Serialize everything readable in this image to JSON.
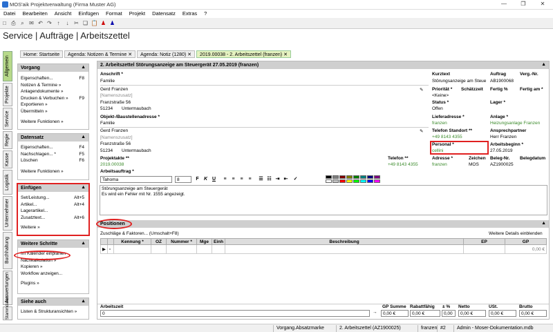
{
  "window": {
    "title": "MOS'aik Projektverwaltung (Firma Muster AG)",
    "min": "—",
    "max": "❐",
    "close": "✕"
  },
  "menu": [
    "Datei",
    "Bearbeiten",
    "Ansicht",
    "Einfügen",
    "Format",
    "Projekt",
    "Datensatz",
    "Extras",
    "?"
  ],
  "app_title": "Service | Aufträge | Arbeitszettel",
  "tabs": [
    {
      "label": "Home: Startseite"
    },
    {
      "label": "Agenda: Notizen & Termine"
    },
    {
      "label": "Agenda: Notiz (1280)"
    },
    {
      "label": "2019.00038 - 2. Arbeitszettel (franzen)"
    }
  ],
  "tab_close": "✕",
  "vtabs": [
    "Allgemein",
    "Projekte",
    "Service",
    "Regie",
    "Kasse",
    "Logistik",
    "Unternehmer",
    "Buchhaltung",
    "Auswertungen",
    "Stammdaten"
  ],
  "left": {
    "vorgang": {
      "title": "Vorgang",
      "items": [
        {
          "label": "Eigenschaften...",
          "key": "F8"
        },
        {
          "label": "Notizen & Termine »",
          "key": ""
        },
        {
          "label": "Anlagendokumente »",
          "key": ""
        },
        {
          "label": "Drucken & Verbuchen »",
          "key": "F9"
        },
        {
          "label": "Exportieren »",
          "key": ""
        },
        {
          "label": "Übermitteln »",
          "key": ""
        }
      ],
      "more": "Weitere Funktionen »"
    },
    "datensatz": {
      "title": "Datensatz",
      "items": [
        {
          "label": "Eigenschaften...",
          "key": "F4"
        },
        {
          "label": "Nachschlagen... *",
          "key": "F5"
        },
        {
          "label": "Löschen",
          "key": "F6"
        }
      ],
      "more": "Weitere Funktionen »"
    },
    "einfuegen": {
      "title": "Einfügen",
      "items": [
        {
          "label": "Set/Leistung...",
          "key": "Alt+5"
        },
        {
          "label": "Artikel...",
          "key": "Alt+4"
        },
        {
          "label": "Lagerartikel...",
          "key": ""
        },
        {
          "label": "Zusatztext...",
          "key": "Alt+6"
        }
      ],
      "more": "Weitere »"
    },
    "schritte": {
      "title": "Weitere Schritte",
      "items": [
        {
          "label": "Im Kalender einplanen",
          "key": ""
        },
        {
          "label": "Nachkalkulation »",
          "key": ""
        },
        {
          "label": "Kopieren »",
          "key": ""
        },
        {
          "label": "Workflow anzeigen...",
          "key": ""
        }
      ],
      "more": "Plugins »"
    },
    "siehe": {
      "title": "Siehe auch",
      "items": [
        {
          "label": "Listen & Strukturansichten »",
          "key": ""
        }
      ]
    }
  },
  "form": {
    "header": "2. Arbeitszettel Störungsanzeige am Steuergerät 27.05.2019 (franzen)",
    "anschrift_lbl": "Anschrift *",
    "anschrift_art": "Familie",
    "anschrift_name": "Gerd Franzen",
    "anschrift_zusatz": "[Namenszusatz]",
    "anschrift_str": "Franzstraße 56",
    "anschrift_plz": "51234",
    "anschrift_ort": "Untermaubach",
    "objekt_lbl": "Objekt-/Baustellenadresse *",
    "objekt_art": "Familie",
    "objekt_name": "Gerd Franzen",
    "objekt_zusatz": "[Namenszusatz]",
    "objekt_str": "Franzstraße 56",
    "objekt_plz": "51234",
    "objekt_ort": "Untermaubach",
    "kurztext_lbl": "Kurztext",
    "kurztext": "Störungsanzeige am Steue",
    "auftrag_lbl": "Auftrag",
    "auftrag": "AB1900068",
    "vergnr_lbl": "Verg.-Nr.",
    "prio_lbl": "Priorität *",
    "prio": "<Keine>",
    "schaetz_lbl": "Schätzzeit",
    "fertigp_lbl": "Fertig %",
    "fertigam_lbl": "Fertig am *",
    "status_lbl": "Status *",
    "status": "Offen",
    "lager_lbl": "Lager *",
    "liefer_lbl": "Lieferadresse *",
    "liefer": "franzen",
    "anlage_lbl": "Anlage *",
    "anlage": "Heizungsanlage Franzen",
    "telst_lbl": "Telefon Standort **",
    "telst": "+49 8143 4355",
    "ansp_lbl": "Ansprechpartner",
    "ansp": "Herr Franzen",
    "personal_lbl": "Personal *",
    "personal": "cellini",
    "arbbeg_lbl": "Arbeitsbeginn *",
    "arbbeg": "27.05.2019",
    "projekt_lbl": "Projektakte **",
    "projekt": "2019.00038",
    "telefon_lbl": "Telefon **",
    "telefon": "+49 8143 4355",
    "adresse_lbl": "Adresse *",
    "adresse": "franzen",
    "zeichen_lbl": "Zeichen",
    "zeichen": "MOS",
    "belegnr_lbl": "Beleg-Nr.",
    "belegnr": "AZ1900025",
    "belegdat_lbl": "Belegdatum",
    "arbauftrag_lbl": "Arbeitsauftrag *",
    "font": "Tahoma",
    "size": "8",
    "text1": "Störungsanzeige am Steuergerät",
    "text2": "Es wird ein Fehler mit Nr. 1555 angezeigt."
  },
  "positionen": {
    "title": "Positionen",
    "zuschlaege": "Zuschläge & Faktoren... (Umschalt+F8)",
    "details": "Weitere Details einblenden",
    "columns": [
      "",
      "",
      "Kennung *",
      "OZ",
      "Nummer *",
      "Mge",
      "Einh",
      "Beschreibung",
      "EP",
      "GP"
    ],
    "row_gp": "0,00 €"
  },
  "summary": {
    "arbeitszeit_lbl": "Arbeitszeit",
    "arbeitszeit": "0",
    "gpsumme_lbl": "GP Summe",
    "gpsumme": "0,00 €",
    "rabatt_lbl": "Rabattfähig",
    "rabatt": "0,00 €",
    "pct_lbl": "± %",
    "pct": "0,00",
    "netto_lbl": "Netto",
    "netto": "0,00 €",
    "ust_lbl": "USt.",
    "ust": "0,00 €",
    "brutto_lbl": "Brutto",
    "brutto": "0,00 €"
  },
  "status": [
    "Vorgang.Absatzmarke",
    "2. Arbeitszettel (AZ1900025)",
    "franzen",
    "#2",
    "Admin - Moser-Dokumentation.mdb"
  ],
  "colors": {
    "accent_green": "#3a8a2a",
    "highlight": "#e02020",
    "active_tab": "#e5f2c0"
  }
}
